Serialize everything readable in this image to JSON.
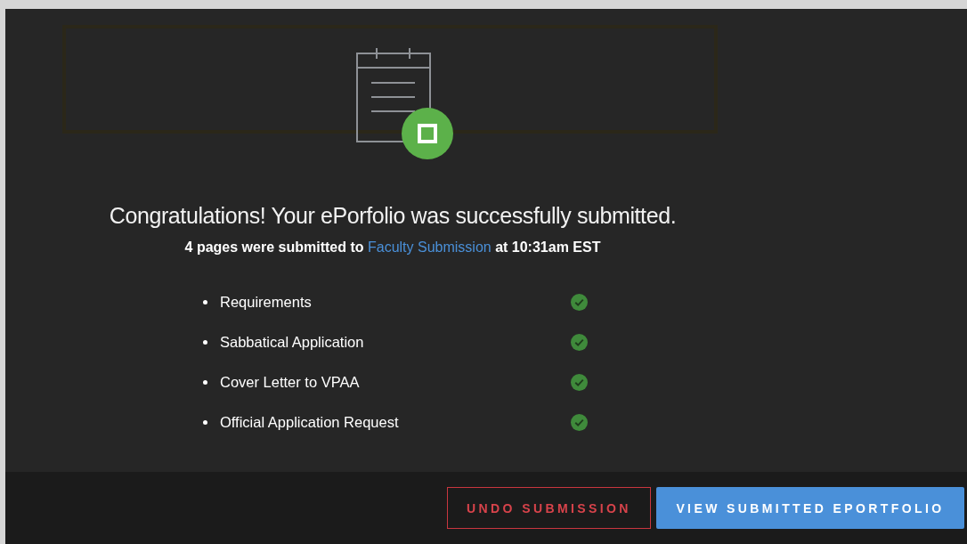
{
  "dialog": {
    "heading": "Congratulations! Your ePorfolio was successfully submitted.",
    "summary_before": "4 pages were submitted to",
    "summary_link": "Faculty Submission",
    "summary_after": "at 10:31am EST",
    "pages": [
      {
        "name": "Requirements",
        "submitted": true
      },
      {
        "name": "Sabbatical Application",
        "submitted": true
      },
      {
        "name": "Cover Letter to VPAA",
        "submitted": true
      },
      {
        "name": "Official Application Request",
        "submitted": true
      }
    ]
  },
  "buttons": [
    {
      "label": "UNDO SUBMISSION",
      "kind": "outline"
    },
    {
      "label": "VIEW SUBMITTED EPORTFOLIO",
      "kind": "primary"
    }
  ]
}
